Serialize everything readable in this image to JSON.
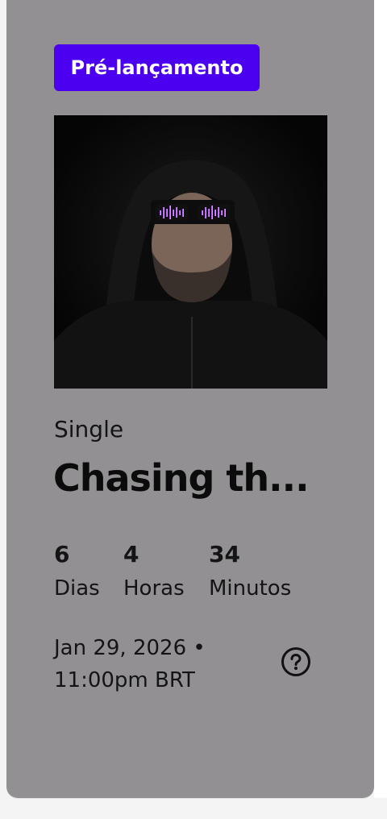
{
  "badge": {
    "label": "Pré-lançamento"
  },
  "release": {
    "type": "Single",
    "title": "Chasing th...",
    "cover_icon": "artist-photo"
  },
  "countdown": [
    {
      "value": "6",
      "unit": "Dias"
    },
    {
      "value": "4",
      "unit": "Horas"
    },
    {
      "value": "34",
      "unit": "Minutos"
    }
  ],
  "date": {
    "line1": "Jan 29, 2026 •",
    "line2": "11:00pm BRT"
  },
  "help": {
    "icon": "question-circle-icon"
  },
  "colors": {
    "card": "#929093",
    "badge": "#4b00f0",
    "text": "#141414"
  }
}
